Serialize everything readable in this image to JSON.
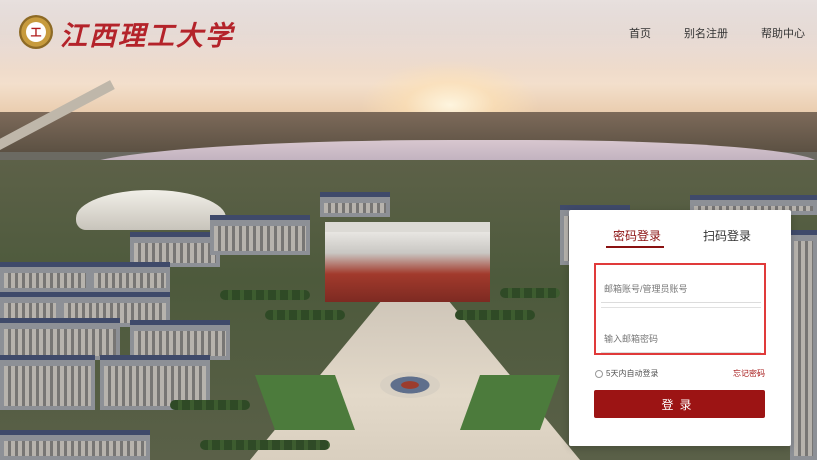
{
  "header": {
    "logo_emblem_text": "工",
    "logo_text": "江西理工大学",
    "nav": [
      {
        "label": "首页"
      },
      {
        "label": "别名注册"
      },
      {
        "label": "帮助中心"
      }
    ]
  },
  "login": {
    "tabs": [
      {
        "label": "密码登录",
        "active": true
      },
      {
        "label": "扫码登录",
        "active": false
      }
    ],
    "email_placeholder": "邮箱账号/管理员账号",
    "password_placeholder": "输入邮箱密码",
    "remember_label": "5天内自动登录",
    "forgot_label": "忘记密码",
    "submit_label": "登录"
  },
  "colors": {
    "brand_red": "#9c1414",
    "tab_active": "#8a1111",
    "highlight_border": "#e03a3a"
  }
}
